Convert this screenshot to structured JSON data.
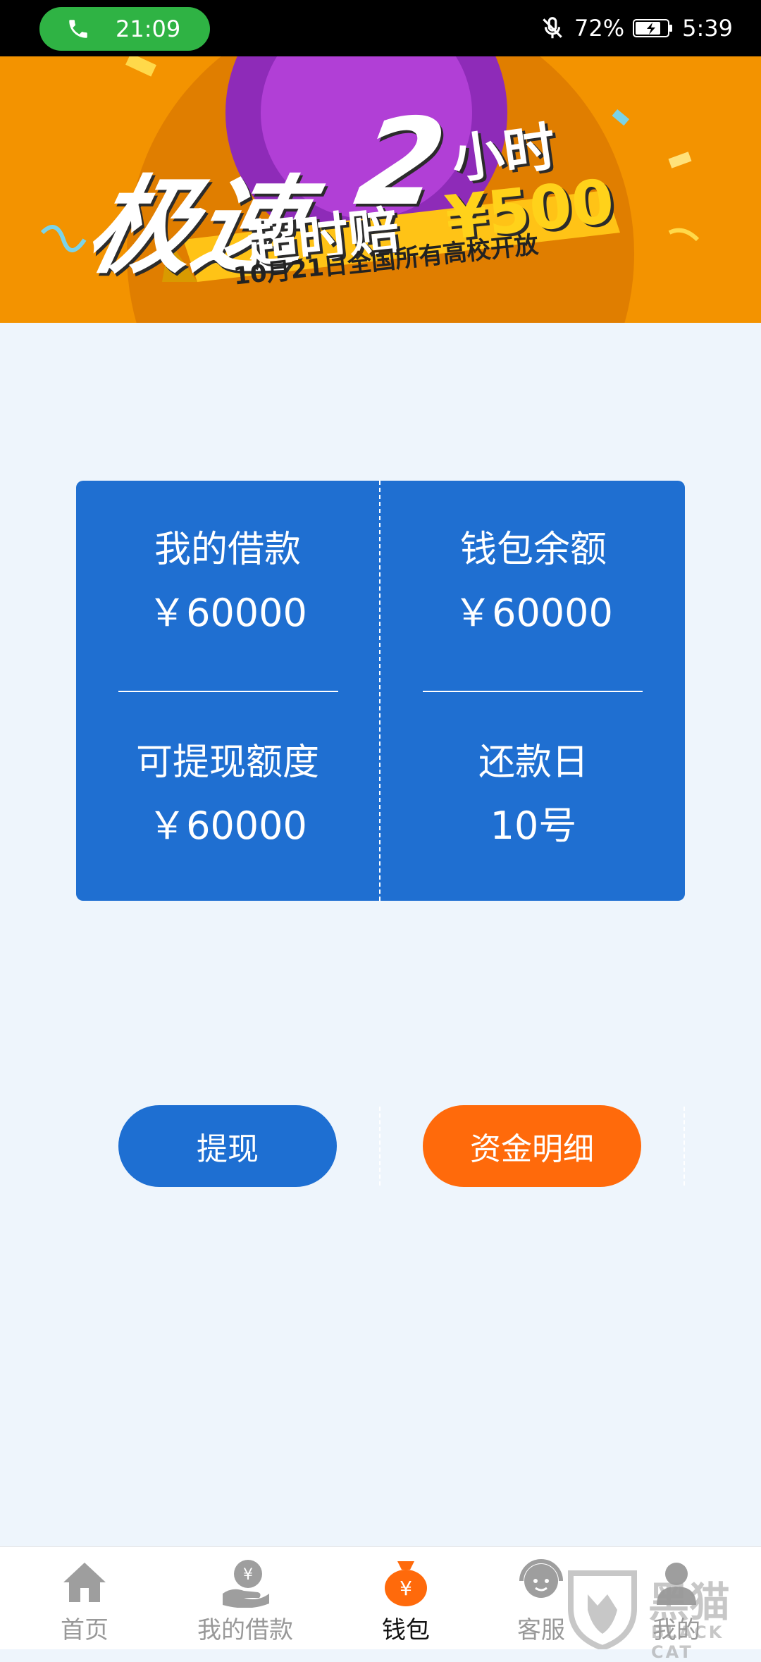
{
  "status_bar": {
    "call_time": "21:09",
    "battery": "72%",
    "clock": "5:39"
  },
  "banner": {
    "headline_big": "极速",
    "headline_number": "2",
    "headline_unit": "小时",
    "headline_sub": "超时赔",
    "headline_money": "¥500",
    "ribbon": "10月21日全国所有高校开放"
  },
  "summary": {
    "my_loan_label": "我的借款",
    "my_loan_value": "￥60000",
    "wallet_balance_label": "钱包余额",
    "wallet_balance_value": "￥60000",
    "withdrawable_label": "可提现额度",
    "withdrawable_value": "￥60000",
    "repay_day_label": "还款日",
    "repay_day_value": "10号"
  },
  "actions": {
    "withdraw_label": "提现",
    "fund_detail_label": "资金明细"
  },
  "bottom_nav": {
    "items": [
      {
        "label": "首页",
        "icon": "home-icon"
      },
      {
        "label": "我的借款",
        "icon": "loan-hand-icon"
      },
      {
        "label": "钱包",
        "icon": "wallet-bag-icon"
      },
      {
        "label": "客服",
        "icon": "customer-service-icon"
      },
      {
        "label": "我的",
        "icon": "user-icon"
      }
    ],
    "active_index": 2
  },
  "watermark": {
    "text": "黑猫",
    "sub": "BLACK CAT"
  },
  "colors": {
    "card_blue": "#1f6fd1",
    "detail_orange": "#ff6a0b",
    "banner_orange": "#f39300",
    "active_nav": "#ff6a0b"
  }
}
